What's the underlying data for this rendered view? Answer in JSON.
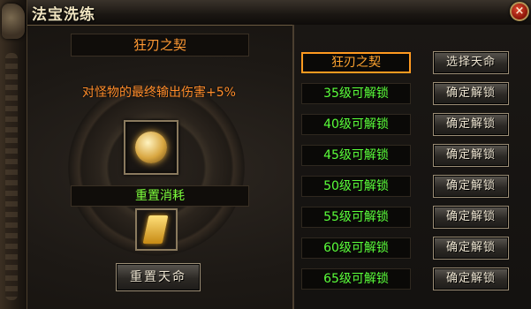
{
  "window": {
    "title": "法宝洗练"
  },
  "left": {
    "treasure_name": "狂刃之契",
    "effect_text": "对怪物的最终输出伤害+5%",
    "cost_label": "重置消耗",
    "reset_button": "重置天命"
  },
  "right": {
    "slots": [
      {
        "text": "狂刃之契",
        "button": "选择天命",
        "active": true
      },
      {
        "text": "35级可解锁",
        "button": "确定解锁",
        "active": false
      },
      {
        "text": "40级可解锁",
        "button": "确定解锁",
        "active": false
      },
      {
        "text": "45级可解锁",
        "button": "确定解锁",
        "active": false
      },
      {
        "text": "50级可解锁",
        "button": "确定解锁",
        "active": false
      },
      {
        "text": "55级可解锁",
        "button": "确定解锁",
        "active": false
      },
      {
        "text": "60级可解锁",
        "button": "确定解锁",
        "active": false
      },
      {
        "text": "65级可解锁",
        "button": "确定解锁",
        "active": false
      }
    ]
  },
  "colors": {
    "active_text": "#ffa430",
    "locked_text": "#5aff3a",
    "effect_text": "#ff8c2a"
  }
}
